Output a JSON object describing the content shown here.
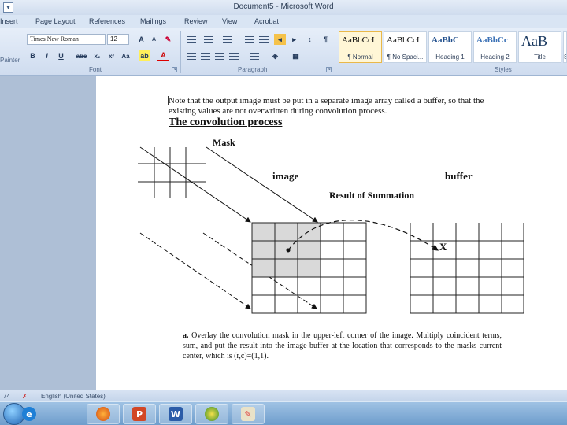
{
  "window": {
    "title": "Document5 - Microsoft Word"
  },
  "tabs": [
    "Insert",
    "Page Layout",
    "References",
    "Mailings",
    "Review",
    "View",
    "Acrobat"
  ],
  "ribbon": {
    "font_name": "Times New Roman",
    "font_size": "12",
    "groups": {
      "font": "Font",
      "paragraph": "Paragraph",
      "styles": "Styles",
      "painter": "Painter"
    },
    "styles": [
      {
        "sample": "AaBbCcI",
        "name": "¶ Normal",
        "selected": true
      },
      {
        "sample": "AaBbCcI",
        "name": "¶ No Spaci...",
        "selected": false
      },
      {
        "sample": "AaBbC",
        "name": "Heading 1",
        "selected": false
      },
      {
        "sample": "AaBbCc",
        "name": "Heading 2",
        "selected": false
      },
      {
        "sample": "AaB",
        "name": "Title",
        "selected": false
      },
      {
        "sample": "A",
        "name": "S",
        "selected": false
      }
    ]
  },
  "document": {
    "paragraph1": "Note that the output image must be put in a separate image array called a buffer, so that the existing values are not overwritten during convolution process.",
    "heading": "The convolution process",
    "diagram": {
      "mask_label": "Mask",
      "image_label": "image",
      "buffer_label": "buffer",
      "sum_label": "Result of Summation",
      "x_mark": "X"
    },
    "step_a_prefix": "a.",
    "step_a_text": "Overlay the convolution mask in the upper-left corner of the image. Multiply coincident terms, sum, and put the result into the image buffer at the location that corresponds to the masks current center, which is (r,c)=(1,1)."
  },
  "statusbar": {
    "page_info": "74",
    "language": "English (United States)"
  },
  "taskbar": {
    "apps": [
      "internet-explorer",
      "firefox",
      "powerpoint",
      "word",
      "media-app",
      "paint"
    ]
  }
}
